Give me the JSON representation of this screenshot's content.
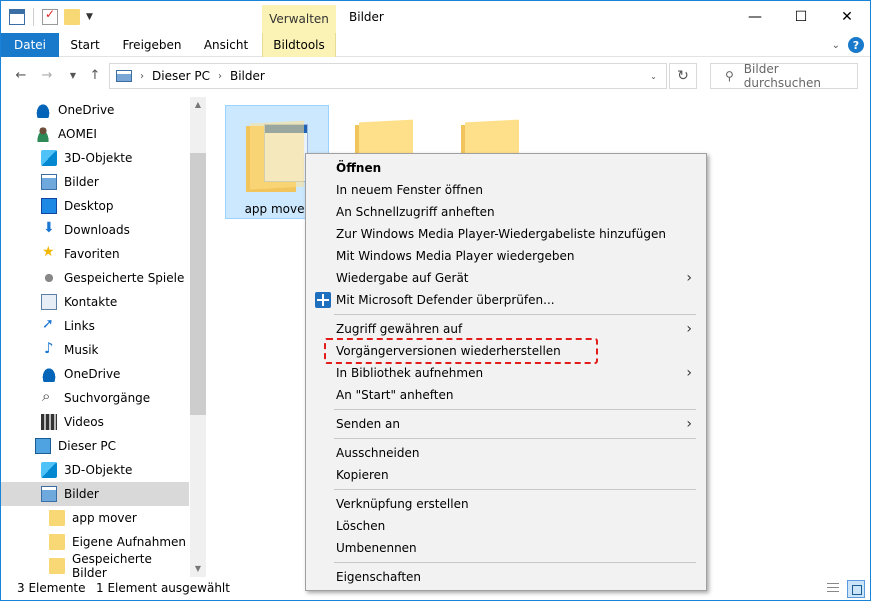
{
  "window": {
    "title": "Bilder",
    "manage_tab": "Verwalten",
    "minimize": "—",
    "maximize": "☐",
    "close": "✕"
  },
  "ribbon": {
    "tabs": [
      "Datei",
      "Start",
      "Freigeben",
      "Ansicht",
      "Bildtools"
    ],
    "collapse": "⌄",
    "help": "?"
  },
  "address": {
    "crumbs": [
      "Dieser PC",
      "Bilder"
    ],
    "search_placeholder": "Bilder durchsuchen"
  },
  "nav": {
    "items": [
      {
        "label": "OneDrive",
        "icon": "onedrive-icon"
      },
      {
        "label": "AOMEI",
        "icon": "user-icon"
      },
      {
        "label": "3D-Objekte",
        "icon": "3d-objects-icon"
      },
      {
        "label": "Bilder",
        "icon": "pictures-icon"
      },
      {
        "label": "Desktop",
        "icon": "desktop-icon"
      },
      {
        "label": "Downloads",
        "icon": "downloads-icon"
      },
      {
        "label": "Favoriten",
        "icon": "star-icon"
      },
      {
        "label": "Gespeicherte Spiele",
        "icon": "games-icon"
      },
      {
        "label": "Kontakte",
        "icon": "contacts-icon"
      },
      {
        "label": "Links",
        "icon": "links-icon"
      },
      {
        "label": "Musik",
        "icon": "music-icon"
      },
      {
        "label": "OneDrive",
        "icon": "onedrive-icon"
      },
      {
        "label": "Suchvorgänge",
        "icon": "search-icon"
      },
      {
        "label": "Videos",
        "icon": "video-icon"
      },
      {
        "label": "Dieser PC",
        "icon": "pc-icon"
      },
      {
        "label": "3D-Objekte",
        "icon": "3d-objects-icon"
      },
      {
        "label": "Bilder",
        "icon": "pictures-icon"
      },
      {
        "label": "app mover",
        "icon": "folder-icon"
      },
      {
        "label": "Eigene Aufnahmen",
        "icon": "folder-icon"
      },
      {
        "label": "Gespeicherte Bilder",
        "icon": "folder-icon"
      }
    ]
  },
  "content": {
    "tiles": [
      {
        "label": "app mover"
      }
    ]
  },
  "context_menu": {
    "open": "Öffnen",
    "new_window": "In neuem Fenster öffnen",
    "pin_quick": "An Schnellzugriff anheften",
    "wmp_add": "Zur Windows Media Player-Wiedergabeliste hinzufügen",
    "wmp_play": "Mit Windows Media Player wiedergeben",
    "cast": "Wiedergabe auf Gerät",
    "defender": "Mit Microsoft Defender überprüfen...",
    "give_access": "Zugriff gewähren auf",
    "restore_versions": "Vorgängerversionen wiederherstellen",
    "include_library": "In Bibliothek aufnehmen",
    "pin_start": "An \"Start\" anheften",
    "send_to": "Senden an",
    "cut": "Ausschneiden",
    "copy": "Kopieren",
    "shortcut": "Verknüpfung erstellen",
    "delete": "Löschen",
    "rename": "Umbenennen",
    "properties": "Eigenschaften",
    "submenu_arrow": "›"
  },
  "status": {
    "count": "3 Elemente",
    "selected": "1 Element ausgewählt"
  }
}
